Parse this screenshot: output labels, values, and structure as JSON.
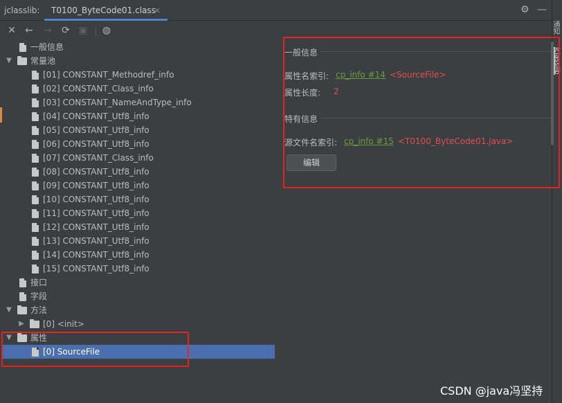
{
  "app": {
    "tool_label": "jclasslib:",
    "tab_title": "T0100_ByteCode01.class",
    "tab_close": "×"
  },
  "toolbar": {
    "icons": [
      "close-icon",
      "back-arrow-icon",
      "forward-arrow-icon",
      "refresh-icon",
      "save-icon",
      "web-icon"
    ]
  },
  "side": {
    "label_top": "通知",
    "label_jclasslib": "jclasslib"
  },
  "tree": {
    "general_info": "一般信息",
    "constant_pool": "常量池",
    "constants": [
      "[01] CONSTANT_Methodref_info",
      "[02] CONSTANT_Class_info",
      "[03] CONSTANT_NameAndType_info",
      "[04] CONSTANT_Utf8_info",
      "[05] CONSTANT_Utf8_info",
      "[06] CONSTANT_Utf8_info",
      "[07] CONSTANT_Class_info",
      "[08] CONSTANT_Utf8_info",
      "[09] CONSTANT_Utf8_info",
      "[10] CONSTANT_Utf8_info",
      "[11] CONSTANT_Utf8_info",
      "[12] CONSTANT_Utf8_info",
      "[13] CONSTANT_Utf8_info",
      "[14] CONSTANT_Utf8_info",
      "[15] CONSTANT_Utf8_info"
    ],
    "interfaces": "接口",
    "fields": "字段",
    "methods": "方法",
    "method_init": "[0] <init>",
    "attributes": "属性",
    "attr_sourcefile": "[0] SourceFile"
  },
  "details": {
    "general_title": "一般信息",
    "name_index_label": "属性名索引:",
    "name_index_link": "cp_info #14",
    "name_index_value": "<SourceFile>",
    "length_label": "属性长度:",
    "length_value": "2",
    "specific_title": "特有信息",
    "source_index_label": "源文件名索引:",
    "source_index_link": "cp_info #15",
    "source_index_value": "<T0100_ByteCode01.java>",
    "edit_button": "编辑"
  },
  "watermark": "CSDN @java冯坚持",
  "colors": {
    "accent": "#4a88c7",
    "selection": "#4b6eaf",
    "link": "#6a9f3c",
    "value_red": "#e05050",
    "highlight_box": "#e8231f"
  }
}
